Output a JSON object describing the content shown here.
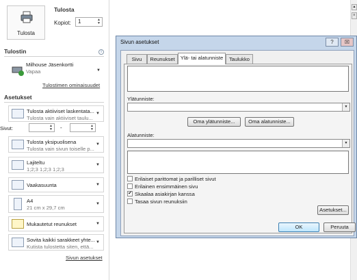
{
  "print": {
    "button_label": "Tulosta",
    "title": "Tulosta",
    "copies_label": "Kopiot:",
    "copies_value": "1"
  },
  "printer": {
    "section": "Tulostin",
    "name": "Milhouse Jäsenkortti",
    "status": "Vapaa",
    "properties_link": "Tulostimen ominaisuudet"
  },
  "settings": {
    "section": "Asetukset",
    "what": {
      "t1": "Tulosta aktiiviset laskentata...",
      "t2": "Tulosta vain aktiiviset taulu..."
    },
    "pages_label": "Sivut:",
    "pages_sep": "-",
    "sides": {
      "t1": "Tulosta yksipuolisena",
      "t2": "Tulosta vain sivun toiselle p..."
    },
    "collate": {
      "t1": "Lajiteltu",
      "t2": "1;2;3   1;2;3   1;2;3"
    },
    "orientation": {
      "t1": "Vaakasuunta"
    },
    "paper": {
      "t1": "A4",
      "t2": "21 cm x 29,7 cm"
    },
    "margins": {
      "t1": "Mukautetut reunukset"
    },
    "scaling": {
      "t1": "Sovita kaikki sarakkeet yhte...",
      "t2": "Kutista tulostetta siten, että..."
    },
    "page_setup_link": "Sivun asetukset"
  },
  "dialog": {
    "title": "Sivun asetukset",
    "help": "?",
    "close": "☒",
    "tabs": [
      "Sivu",
      "Reunukset",
      "Ylä- tai alatunniste",
      "Taulukko"
    ],
    "header_label": "Ylätunniste:",
    "custom_header": "Oma ylätunniste...",
    "custom_footer": "Oma alatunniste...",
    "footer_label": "Alatunniste:",
    "checkboxes": [
      {
        "label": "Erilaiset parittomat ja parilliset sivut",
        "checked": false
      },
      {
        "label": "Erilainen ensimmäinen sivu",
        "checked": false
      },
      {
        "label": "Skaalaa asiakirjan kanssa",
        "checked": true
      },
      {
        "label": "Tasaa sivun reunuksiin",
        "checked": false
      }
    ],
    "options_button": "Asetukset...",
    "ok": "OK",
    "cancel": "Peruuta"
  },
  "icons": {
    "printer": "printer-icon",
    "dropdown": "chevron-down-icon",
    "info": "info-icon",
    "check": "✔",
    "check_mark": "✓"
  }
}
